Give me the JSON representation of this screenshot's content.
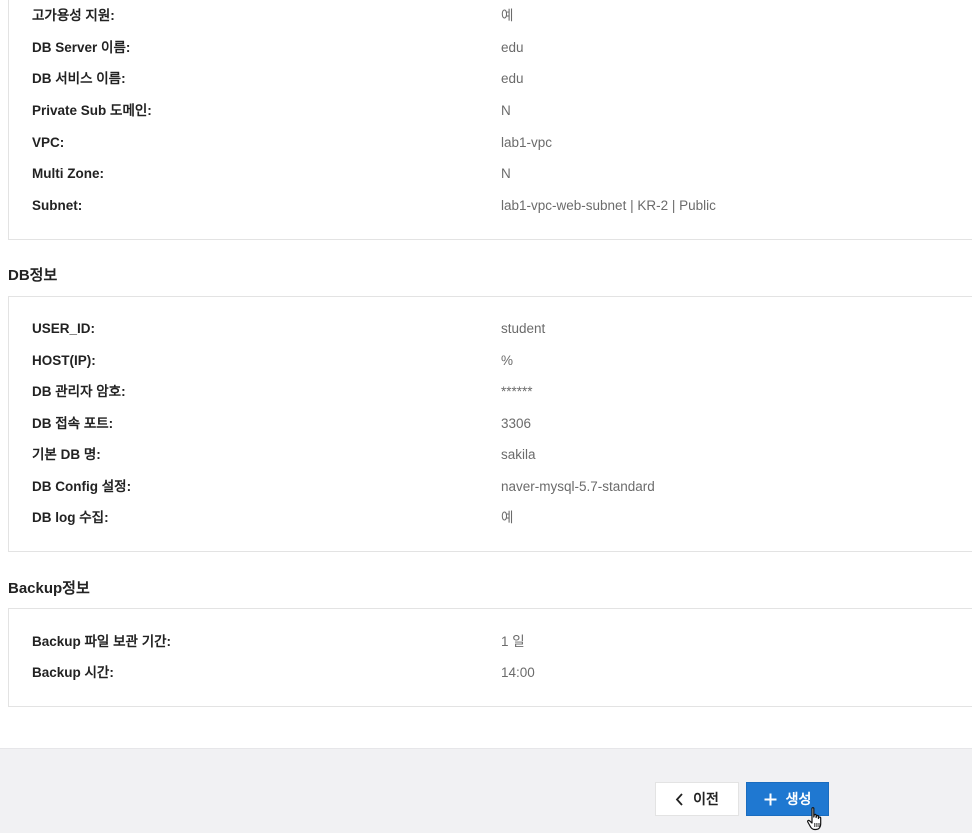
{
  "server_info": {
    "rows": [
      {
        "label": "고가용성 지원:",
        "value": "예"
      },
      {
        "label": "DB Server 이름:",
        "value": "edu"
      },
      {
        "label": "DB 서비스 이름:",
        "value": "edu"
      },
      {
        "label": "Private Sub 도메인:",
        "value": "N"
      },
      {
        "label": "VPC:",
        "value": "lab1-vpc"
      },
      {
        "label": "Multi Zone:",
        "value": "N"
      },
      {
        "label": "Subnet:",
        "value": "lab1-vpc-web-subnet | KR-2 | Public"
      }
    ]
  },
  "db_info": {
    "title": "DB정보",
    "rows": [
      {
        "label": "USER_ID:",
        "value": "student"
      },
      {
        "label": "HOST(IP):",
        "value": "%"
      },
      {
        "label": "DB 관리자 암호:",
        "value": "******"
      },
      {
        "label": "DB 접속 포트:",
        "value": "3306"
      },
      {
        "label": "기본 DB 명:",
        "value": "sakila"
      },
      {
        "label": "DB Config 설정:",
        "value": "naver-mysql-5.7-standard"
      },
      {
        "label": "DB log 수집:",
        "value": "예"
      }
    ]
  },
  "backup_info": {
    "title": "Backup정보",
    "rows": [
      {
        "label": "Backup 파일 보관 기간:",
        "value": "1 일"
      },
      {
        "label": "Backup 시간:",
        "value": "14:00"
      }
    ]
  },
  "footer": {
    "prev_label": "이전",
    "create_label": "생성",
    "prev_icon": "chevron-left-icon",
    "create_icon": "plus-icon"
  },
  "colors": {
    "primary_button": "#1f78d1",
    "footer_background": "#f1f1f3",
    "label_text": "#222222",
    "value_text": "#6b6b6b",
    "panel_border": "#e3e3e3"
  }
}
